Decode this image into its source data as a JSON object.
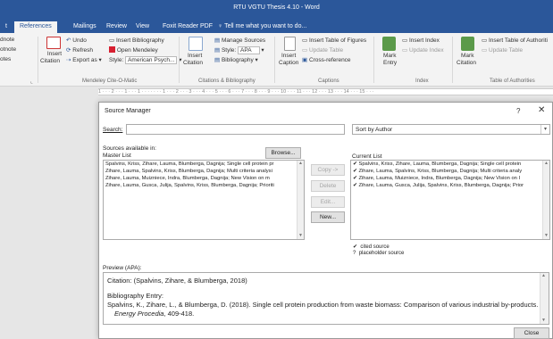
{
  "window": {
    "title": "RTU VGTU Thesis 4.10 - Word"
  },
  "tabs": [
    {
      "label": "t"
    },
    {
      "label": "References"
    },
    {
      "label": "Mailings"
    },
    {
      "label": "Review"
    },
    {
      "label": "View"
    },
    {
      "label": "Foxit Reader PDF"
    },
    {
      "label": "Tell me what you want to do..."
    }
  ],
  "ribbon": {
    "footnote_partial": [
      "dnote",
      "otnote",
      "otes"
    ],
    "insert_citation": [
      "Insert",
      "Citation"
    ],
    "undo": "Undo",
    "refresh": "Refresh",
    "export_as": "Export as",
    "insert_bibliography": "Insert Bibliography",
    "open_mendeley": "Open Mendeley",
    "style_label": "Style:",
    "style_value": "American Psych...",
    "mendeley_group": "Mendeley Cite-O-Matic",
    "insert_citation2": [
      "Insert",
      "Citation"
    ],
    "manage_sources": "Manage Sources",
    "style2_label": "Style:",
    "style2_value": "APA",
    "bibliography": "Bibliography",
    "citations_group": "Citations & Bibliography",
    "insert_caption": [
      "Insert",
      "Caption"
    ],
    "insert_table_of_figures": "Insert Table of Figures",
    "update_table": "Update Table",
    "cross_reference": "Cross-reference",
    "captions_group": "Captions",
    "mark_entry": [
      "Mark",
      "Entry"
    ],
    "insert_index": "Insert Index",
    "update_index": "Update Index",
    "index_group": "Index",
    "mark_citation": [
      "Mark",
      "Citation"
    ],
    "insert_table_of_authorities": "Insert Table of Authoriti",
    "update_table2": "Update Table",
    "authorities_group": "Table of Authorities",
    "group_launcher": "⌞"
  },
  "ruler_text": "1 · · · 2 · · · 1 · · · 1 · · ·  ·  ·   ·   · 1 · · · 2 · · · 3 · · · 4 · · · 5 · · · 6 · · · 7 · · · 8 · · · 9 · · · 10 · · · 11 · · · 12 · · · 13 · · · 14 · · · 15 · · ·",
  "dialog": {
    "title": "Source Manager",
    "help": "?",
    "close_icon": "✕",
    "search_label": "Search:",
    "search_value": "",
    "sort_value": "Sort by Author",
    "sources_label": "Sources available in:",
    "master_label": "Master List",
    "browse_label": "Browse...",
    "current_label": "Current List",
    "copy_label": "Copy ->",
    "delete_label": "Delete",
    "edit_label": "Edit...",
    "new_label": "New...",
    "master_list": [
      "Spalvins, Kriss, Zihare, Lauma, Blumberga, Dagnija; Single cell protein pr",
      "Zihare, Lauma, Spalvins, Kriss, Blumberga, Dagnija; Multi criteria analysi",
      "Zihare, Lauma, Muizniece, Indra, Blumberga, Dagnija; New Vision on m",
      "Zihare, Lauma, Gusca, Julija, Spalvins, Kriss, Blumberga, Dagnija; Prioriti"
    ],
    "current_list": [
      "✔ Spalvins, Kriss, Zihare, Lauma, Blumberga, Dagnija; Single cell protein",
      "✔ Zihare, Lauma, Spalvins, Kriss, Blumberga, Dagnija; Multi criteria analy",
      "✔ Zihare, Lauma, Muizniece, Indra, Blumberga, Dagnija; New Vision on I",
      "✔ Zihare, Lauma, Gusca, Julija, Spalvins, Kriss, Blumberga, Dagnija; Prior"
    ],
    "legend_cited_mark": "✔",
    "legend_cited": "cited source",
    "legend_placeholder_mark": "?",
    "legend_placeholder": "placeholder source",
    "preview_label": "Preview (APA):",
    "preview_citation": "Citation:  (Spalvins, Zihare, & Blumberga, 2018)",
    "preview_bib_heading": "Bibliography Entry:",
    "preview_bib_entry": "Spalvins, K., Zihare, L., & Blumberga, D. (2018). Single cell protein production from waste biomass: Comparison of various industrial by-products.",
    "preview_journal": "Energy Procedia",
    "preview_pages": ", 409-418.",
    "close_button": "Close"
  },
  "colors": {
    "word_blue": "#2b579a",
    "ribbon_bg": "#f3f3f3",
    "mendeley_red": "#d71f30"
  },
  "icons": {
    "scroll_up": "▲",
    "scroll_down": "▼",
    "dropdown": "▾"
  }
}
